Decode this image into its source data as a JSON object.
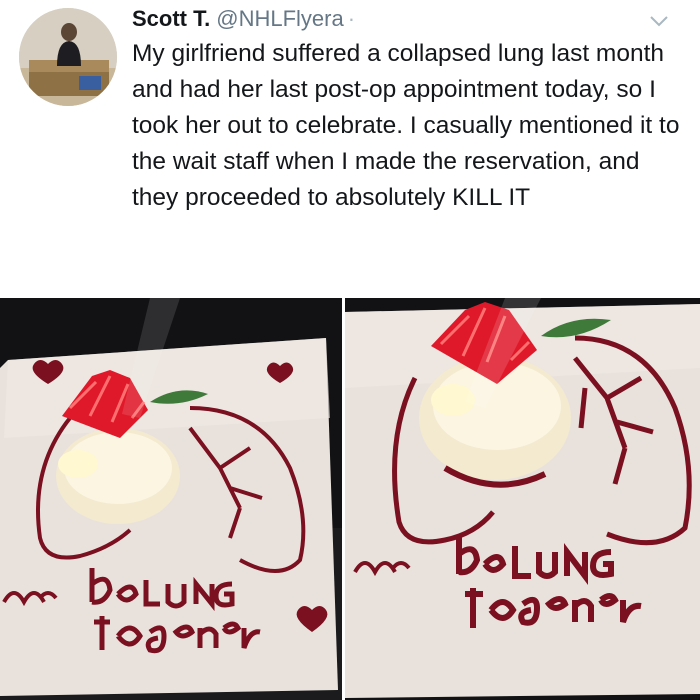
{
  "tweet": {
    "author_name": "Scott T.",
    "author_handle": "@NHLFlyera",
    "text": "My girlfriend suffered a collapsed lung last month and had her last post-op appointment today, so I took her out to celebrate. I casually mentioned it to the wait staff when I made the reservation, and they proceeded to absolutely KILL IT",
    "more_icon": "chevron-down-icon"
  },
  "photos": [
    {
      "icon": "dessert-photo",
      "handwriting": "we beLUNG together"
    },
    {
      "icon": "dessert-photo",
      "handwriting": "we beLUNG together"
    }
  ],
  "colors": {
    "text": "#14171a",
    "handle": "#657786",
    "syrup": "#7a1020",
    "plate": "#e9e2dc"
  }
}
